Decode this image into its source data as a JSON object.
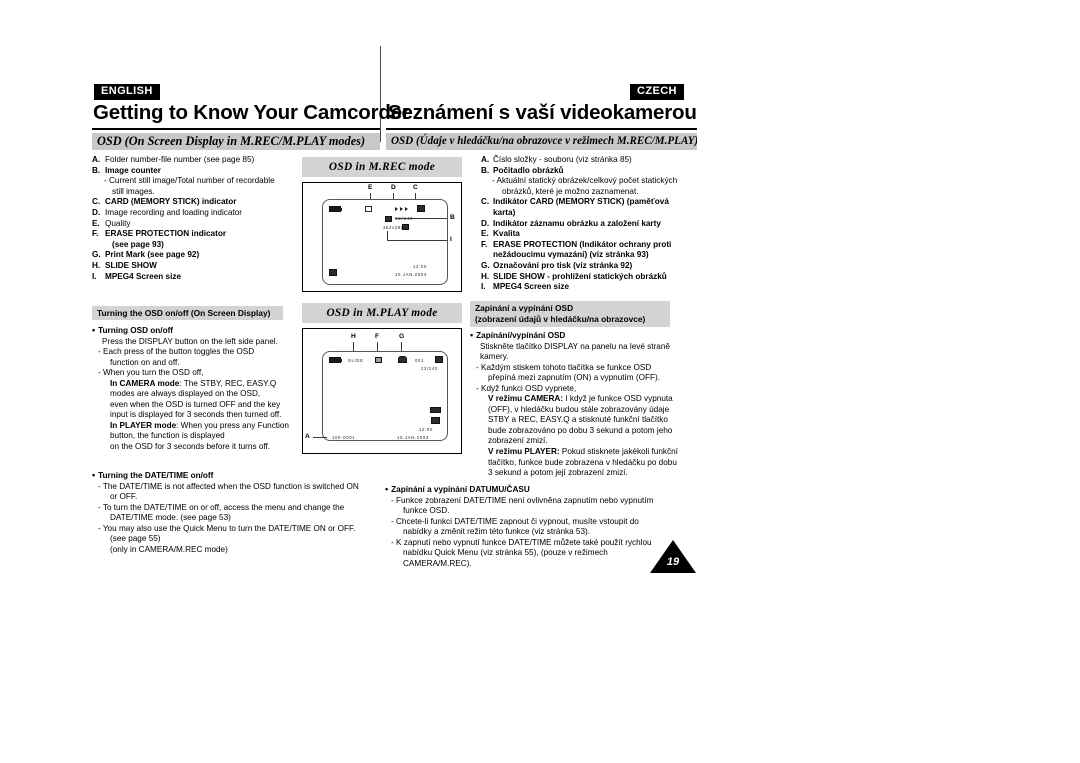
{
  "header": {
    "lang_left": "ENGLISH",
    "lang_right": "CZECH",
    "title_left": "Getting to Know Your Camcorder",
    "title_right": "Seznámení s vaší videokamerou",
    "band_left": "OSD (On Screen Display in M.REC/M.PLAY modes)",
    "band_right": "OSD (Údaje v hledáčku/na obrazovce v režimech M.REC/M.PLAY)"
  },
  "list_en": [
    {
      "key": "A.",
      "text": "Folder number-file number (see page 85)"
    },
    {
      "key": "B.",
      "text": "Image counter"
    },
    {
      "key": "",
      "text": "- Current still image/Total number of recordable",
      "sub": true
    },
    {
      "key": "",
      "text": "still images.",
      "deep": true
    },
    {
      "key": "C.",
      "text": "CARD (MEMORY STICK) indicator",
      "bold": true
    },
    {
      "key": "D.",
      "text": "Image recording and loading indicator"
    },
    {
      "key": "E.",
      "text": "Quality"
    },
    {
      "key": "F.",
      "text": "ERASE PROTECTION indicator",
      "bold": true
    },
    {
      "key": "",
      "text": "(see page 93)",
      "deep": true,
      "bold": true
    },
    {
      "key": "G.",
      "text": "Print Mark (see page 92)"
    },
    {
      "key": "H.",
      "text": "SLIDE SHOW",
      "bold": true
    },
    {
      "key": "I.",
      "text": "MPEG4 Screen size",
      "bold": true
    }
  ],
  "list_cz": [
    {
      "key": "A.",
      "text": "Číslo složky - souboru (viz stránka 85)"
    },
    {
      "key": "B.",
      "text": "Počitadlo obrázků"
    },
    {
      "key": "",
      "text": "- Aktuální statický obrázek/celkový počet statických",
      "sub": true
    },
    {
      "key": "",
      "text": "obrázků, které je možno zaznamenat.",
      "deep": true
    },
    {
      "key": "C.",
      "text": "Indikátor CARD (MEMORY STICK) (paměťová"
    },
    {
      "key": "",
      "text": "karta)",
      "deep": false,
      "nokey": true
    },
    {
      "key": "D.",
      "text": "Indikátor záznamu obrázku a založení karty"
    },
    {
      "key": "E.",
      "text": "Kvalita"
    },
    {
      "key": "F.",
      "text": "ERASE PROTECTION (Indikátor ochrany proti"
    },
    {
      "key": "",
      "text": "nežádoucimu vymazání) (viz stránka 93)",
      "nokey": true
    },
    {
      "key": "G.",
      "text": "Označování pro tisk (viz stránka 92)"
    },
    {
      "key": "H.",
      "text": "SLIDE SHOW - prohlížení statických obrázků"
    },
    {
      "key": "I.",
      "text": "MPEG4 Screen size"
    }
  ],
  "subband_en": "Turning the OSD on/off (On Screen Display)",
  "subband_cz_line1": "Zapinání a vypínání OSD",
  "subband_cz_line2": "(zobrazení údajů v hledáčku/na obrazovce)",
  "body_en": {
    "b1_title": "Turning OSD on/off",
    "b1_l1": "Press the DISPLAY button on the left side panel.",
    "b1_l2": "- Each press of the button toggles the OSD",
    "b1_l3": "function on and off.",
    "b1_l4": "- When you turn the OSD off,",
    "b1_l5_bold": "In CAMERA mode",
    "b1_l5_rest": ": The STBY, REC, EASY.Q",
    "b1_l6": "modes are always displayed on the OSD,",
    "b1_l7": "even when the OSD is turned OFF and the key",
    "b1_l8": "input is displayed for 3 seconds then turned off.",
    "b1_l9_bold": "In PLAYER mode",
    "b1_l9_rest": ": When you press any Function",
    "b1_l10": "button, the function is displayed",
    "b1_l11": "on the OSD for 3 seconds before it turns off."
  },
  "body_en2": {
    "b2_title": "Turning the DATE/TIME on/off",
    "l1": "- The DATE/TIME is not affected when the OSD function is switched ON",
    "l2": "or OFF.",
    "l3": "- To turn the DATE/TIME on or off, access the menu and change the",
    "l4": "DATE/TIME mode. (see page 53)",
    "l5": "- You may also use the Quick Menu to turn the DATE/TIME ON or OFF.",
    "l6": "(see page 55)",
    "l7": "(only in CAMERA/M.REC mode)"
  },
  "body_cz": {
    "b1_title": "Zapínání/vypínání OSD",
    "l1": "Stiskněte tlačítko DISPLAY na panelu na levé straně",
    "l2": "kamery.",
    "l3": "- Každým stiskem tohoto tlačítka se funkce OSD",
    "l4": "přepíná mezi zapnutím (ON) a vypnutím (OFF).",
    "l5": "- Když funkci OSD vypnete,",
    "l6_bold": "V režimu CAMERA:",
    "l6_rest": " I když je funkce OSD vypnuta",
    "l7": "(OFF), v hledáčku budou stále zobrazovány údaje",
    "l8": "STBY a REC, EASY.Q a stisknuté funkční tlačítko",
    "l9": "bude zobrazováno po dobu 3 sekund a potom jeho",
    "l10": "zobrazení zmizí.",
    "l11_bold": "V režimu PLAYER:",
    "l11_rest": " Pokud stisknete jakékoli funkční",
    "l12": "tlačítko, funkce bude zobrazena v hledáčku po dobu",
    "l13": "3 sekund a potom její zobrazení zmizí."
  },
  "body_cz2": {
    "b2_title": "Zapínání a vypínání DATUMU/ČASU",
    "l1": "- Funkce zobrazení DATE/TIME není ovlivněna zapnutím nebo vypnutím",
    "l2": "funkce OSD.",
    "l3": "- Chcete-li funkci DATE/TIME zapnout či vypnout, musíte vstoupit do",
    "l4": "nabídky a změnit režim této funkce (viz stránka 53).",
    "l5": "- K zapnutí nebo vypnutí funkce DATE/TIME můžete také použít rychlou",
    "l6": "nabídku Quick Menu (viz stránka 55), (pouze v režimech",
    "l7": "CAMERA/M.REC)."
  },
  "panels": {
    "rec_title": "OSD in M.REC mode",
    "play_title": "OSD in M.PLAY mode",
    "rec_osd": {
      "counter": "22/240",
      "size": "352x288",
      "time": "12:00",
      "date": "10.JAN.2003",
      "callouts": [
        "E",
        "D",
        "C",
        "B",
        "I"
      ]
    },
    "play_osd": {
      "slide_label": "SLIDE",
      "index": "001",
      "counter": "22/240",
      "file": "100-0001",
      "time": "12:00",
      "date": "10.JAN.2003",
      "callouts": [
        "H",
        "F",
        "G",
        "A"
      ]
    }
  },
  "page_number": "19"
}
